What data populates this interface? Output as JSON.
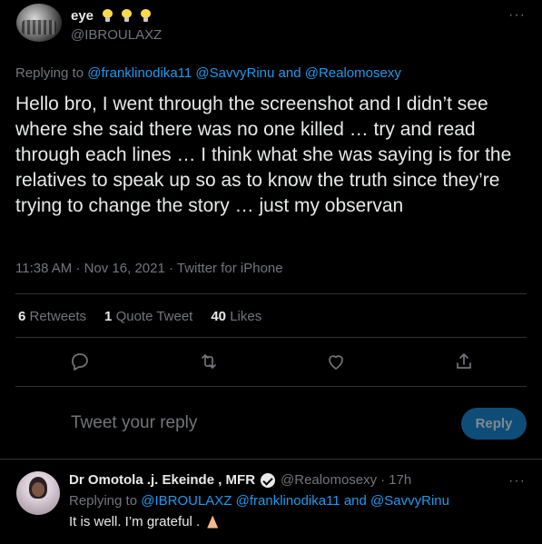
{
  "tweet": {
    "display_name": "eye",
    "emoji_icons": [
      "lightbulb-icon",
      "lightbulb-icon",
      "lightbulb-icon"
    ],
    "handle": "@IBROULAXZ",
    "more": "···",
    "replying_prefix": "Replying to",
    "replying_users": [
      "@franklinodika11",
      "@SavvyRinu"
    ],
    "replying_and": "and",
    "replying_last": "@Realomosexy",
    "text": "Hello bro, I went through the screenshot and I didn’t see where she said there was no one killed … try and read through each lines … I think what she was saying is for the relatives to speak up so as to know the truth since they’re trying to change the story … just my observan",
    "timestamp": "11:38 AM · Nov 16, 2021 · Twitter for iPhone",
    "stats": [
      {
        "count": "6",
        "label": "Retweets"
      },
      {
        "count": "1",
        "label": "Quote Tweet"
      },
      {
        "count": "40",
        "label": "Likes"
      }
    ]
  },
  "composer": {
    "placeholder": "Tweet your reply",
    "button_label": "Reply"
  },
  "reply": {
    "display_name": "Dr Omotola .j. Ekeinde , MFR",
    "handle": "@Realomosexy",
    "dot": "·",
    "time": "17h",
    "more": "···",
    "replying_prefix": "Replying to",
    "replying_users": [
      "@IBROULAXZ",
      "@franklinodika11"
    ],
    "replying_and": "and",
    "replying_last": "@SavvyRinu",
    "text": "It is well. I’m grateful .",
    "emoji_icon": "folded-hands-icon"
  },
  "colors": {
    "background": "#000000",
    "text": "#e7e9ea",
    "muted": "#71767b",
    "link": "#1d9bf0",
    "reply_button_disabled": "#0e4d78",
    "divider": "#2f3336"
  }
}
